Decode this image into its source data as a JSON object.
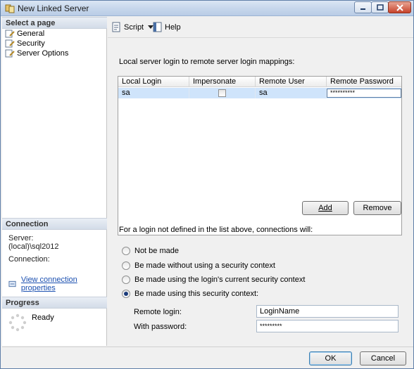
{
  "window": {
    "title": "New Linked Server"
  },
  "left": {
    "select_page_header": "Select a page",
    "pages": [
      {
        "label": "General",
        "icon": "wrench-page-icon"
      },
      {
        "label": "Security",
        "icon": "wrench-page-icon"
      },
      {
        "label": "Server Options",
        "icon": "wrench-page-icon"
      }
    ],
    "connection_header": "Connection",
    "server_label": "Server:",
    "server_value": "(local)\\sql2012",
    "connection_label": "Connection:",
    "view_connection_link": "View connection properties",
    "progress_header": "Progress",
    "progress_status": "Ready"
  },
  "toolbar": {
    "script_label": "Script",
    "help_label": "Help"
  },
  "security": {
    "mappings_label": "Local server login to remote server login mappings:",
    "columns": [
      "Local Login",
      "Impersonate",
      "Remote User",
      "Remote Password"
    ],
    "rows": [
      {
        "local_login": "sa",
        "impersonate": false,
        "remote_user": "sa",
        "remote_password": "**********"
      }
    ],
    "add_label": "Add",
    "remove_label": "Remove",
    "not_defined_label": "For a login not defined in the list above, connections will:",
    "options": [
      {
        "label": "Not be made",
        "selected": false
      },
      {
        "label": "Be made without using a security context",
        "selected": false
      },
      {
        "label": "Be made using the login's current security context",
        "selected": false
      },
      {
        "label": "Be made using this security context:",
        "selected": true
      }
    ],
    "remote_login_label": "Remote login:",
    "remote_login_value": "LoginName",
    "with_password_label": "With password:",
    "with_password_value": "*********"
  },
  "footer": {
    "ok_label": "OK",
    "cancel_label": "Cancel"
  }
}
